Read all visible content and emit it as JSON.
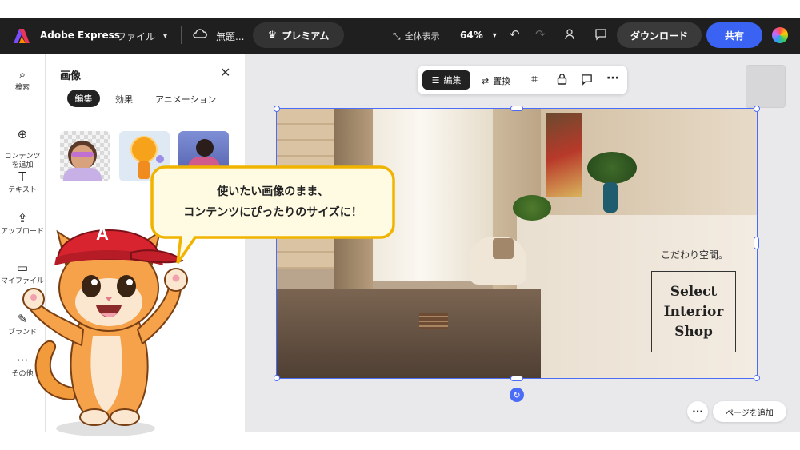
{
  "topbar": {
    "brand": "Adobe Express",
    "file_menu": "ファイル",
    "doc_title": "無題...",
    "premium": "プレミアム",
    "fullscreen": "全体表示",
    "zoom": "64%",
    "download": "ダウンロード",
    "share": "共有"
  },
  "rail": {
    "items": [
      {
        "label": "検索",
        "icon": "search-icon"
      },
      {
        "label": "コンテンツ\nを追加",
        "icon": "plus-circle-icon"
      },
      {
        "label": "テキスト",
        "icon": "text-icon"
      },
      {
        "label": "アップロード",
        "icon": "upload-icon"
      },
      {
        "label": "マイファイル",
        "icon": "folder-icon"
      },
      {
        "label": "ブランド",
        "icon": "brand-icon"
      },
      {
        "label": "その他",
        "icon": "more-icon"
      }
    ]
  },
  "panel": {
    "title": "画像",
    "tabs": [
      "編集",
      "効果",
      "アニメーション"
    ]
  },
  "callout": {
    "line1": "使いたい画像のまま、",
    "line2": "コンテンツにぴったりのサイズに！"
  },
  "mascot": {
    "cap_letter": "A"
  },
  "image_toolbar": {
    "edit": "編集",
    "replace": "置換"
  },
  "design": {
    "tagline": "こだわり空間。",
    "box_line1": "Select",
    "box_line2": "Interior",
    "box_line3": "Shop"
  },
  "footer": {
    "add_page": "ページを追加"
  },
  "colors": {
    "accent": "#3b63f3",
    "topbar": "#1f1f1f",
    "selection": "#4a6cf7",
    "callout_border": "#f0b400",
    "callout_fill": "#fffbe3"
  }
}
